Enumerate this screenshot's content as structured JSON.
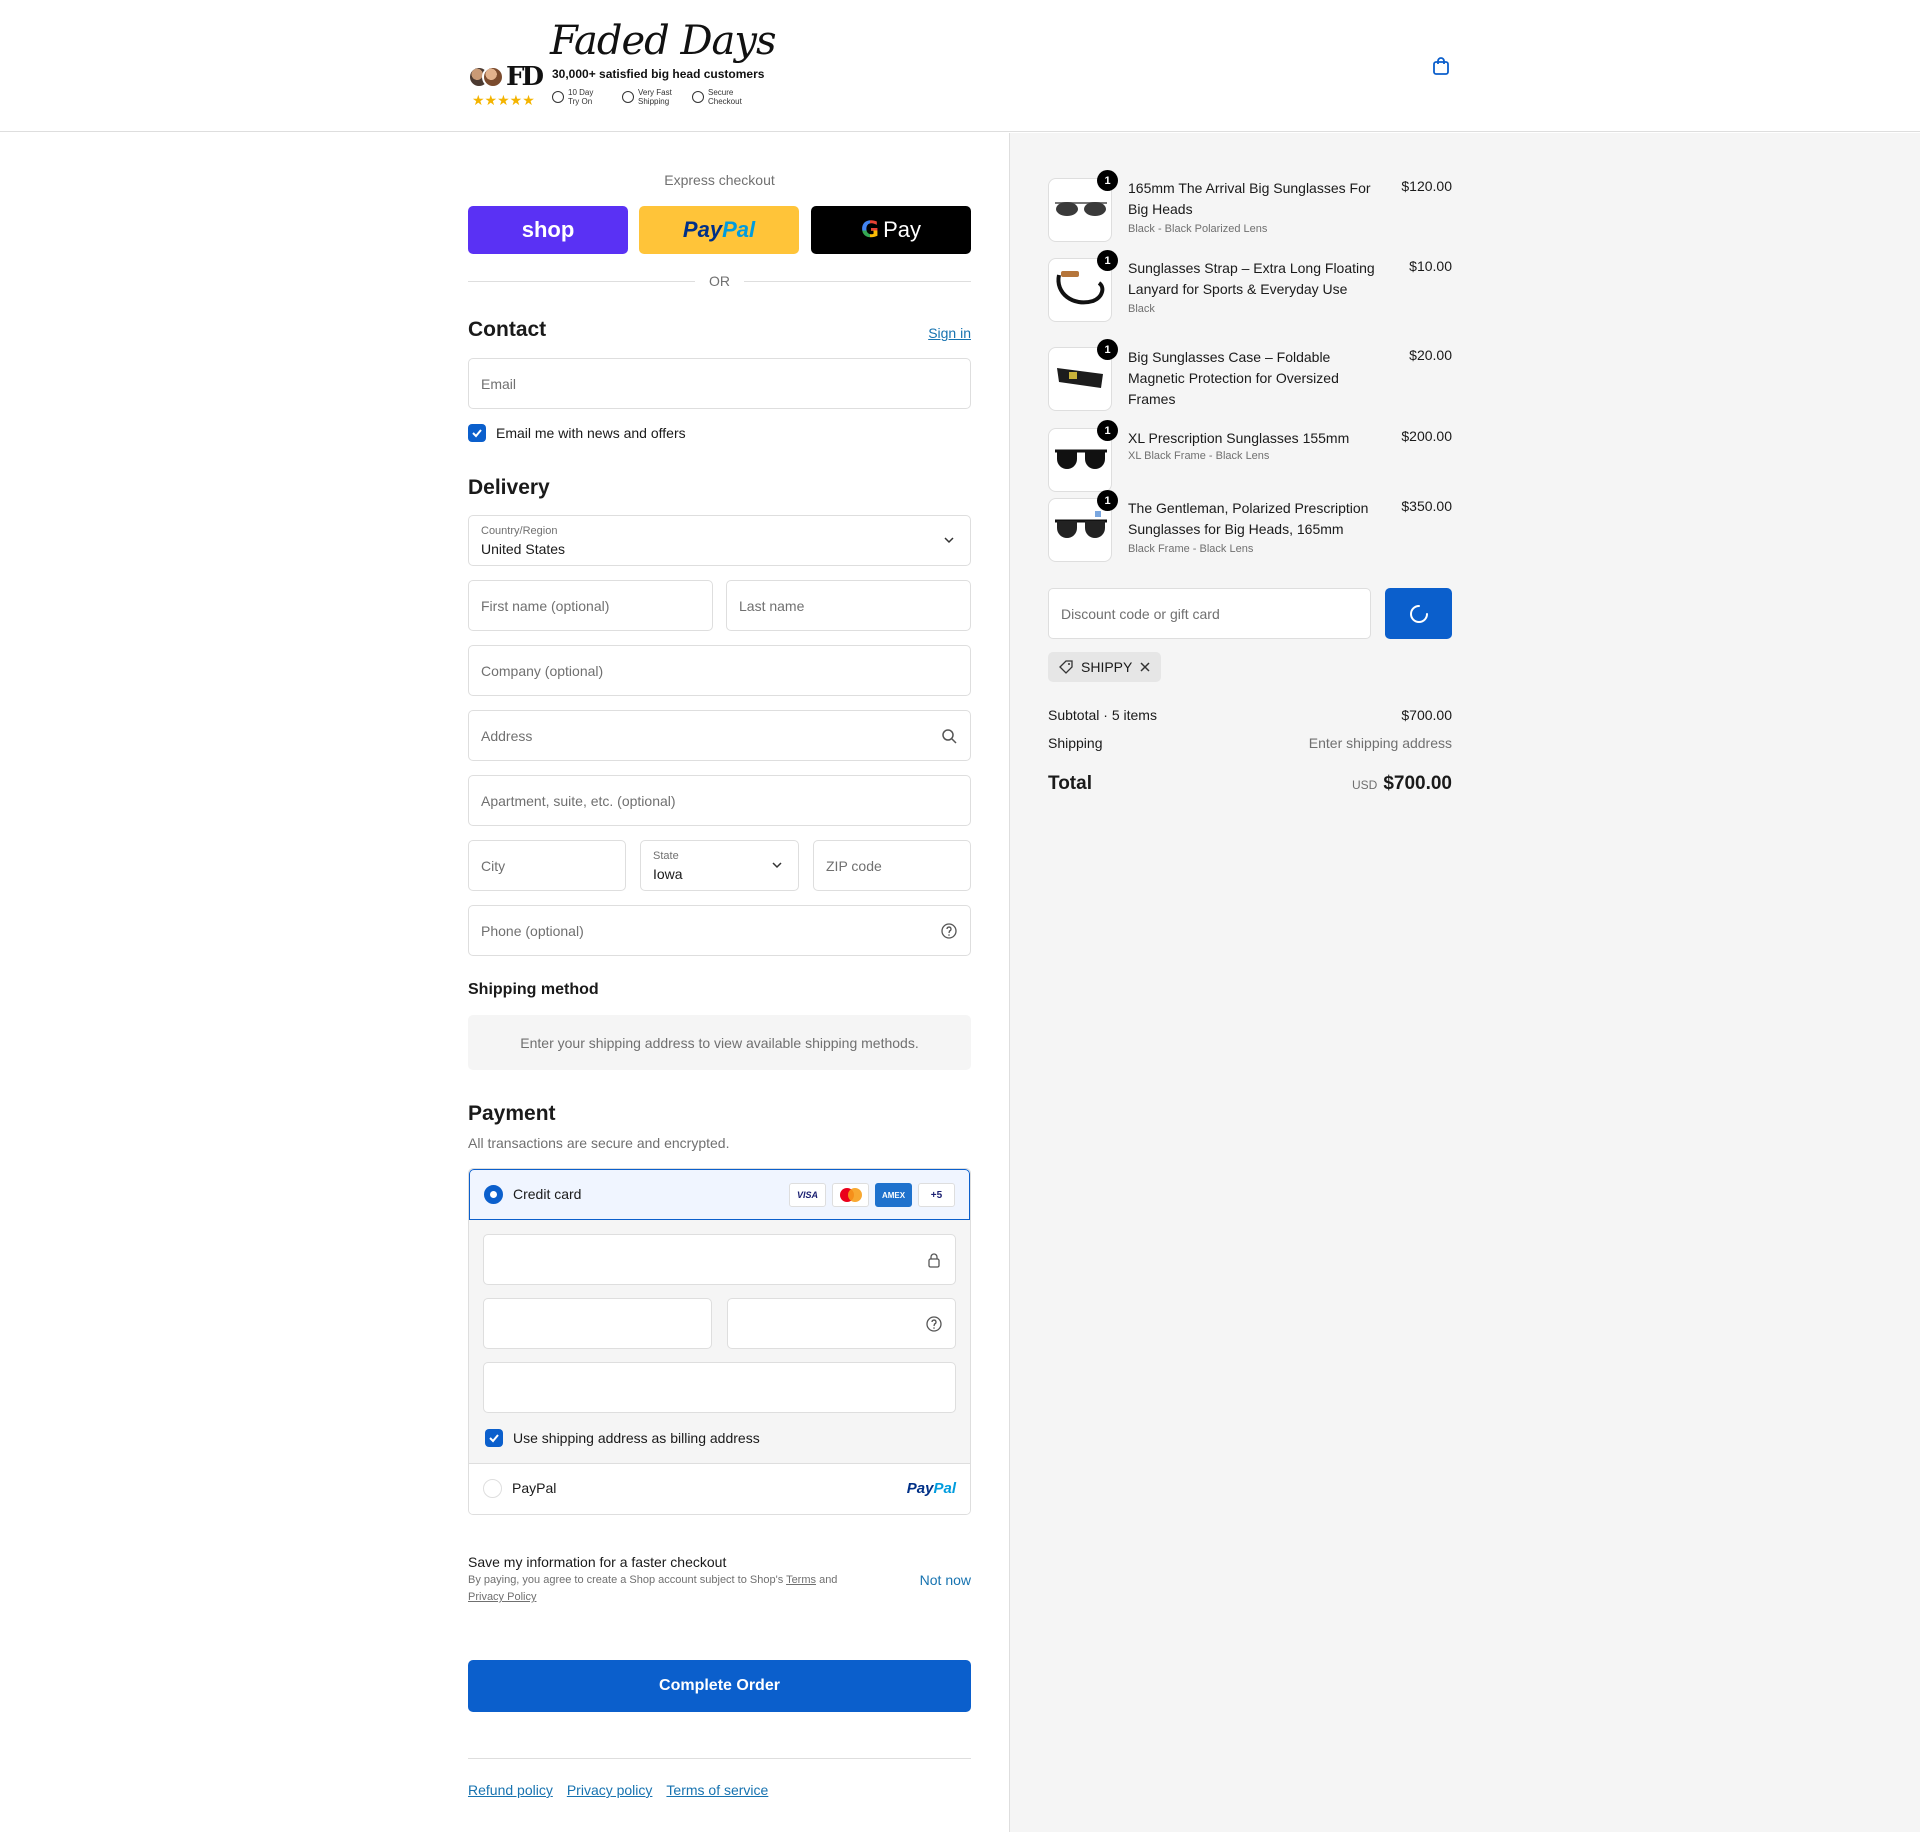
{
  "header": {
    "brand": "Faded Days",
    "monogram": "FD",
    "rating_stars": "★★★★★",
    "tagline": "30,000+ satisfied big head customers",
    "badges": [
      {
        "line1": "10 Day",
        "line2": "Try On"
      },
      {
        "line1": "Very Fast",
        "line2": "Shipping"
      },
      {
        "line1": "Secure",
        "line2": "Checkout"
      }
    ]
  },
  "express": {
    "title": "Express checkout",
    "shop_label": "shop",
    "paypal_part1": "Pay",
    "paypal_part2": "Pal",
    "gpay_g": "G",
    "gpay_label": "Pay",
    "or_label": "OR"
  },
  "contact": {
    "title": "Contact",
    "signin": "Sign in",
    "email_placeholder": "Email",
    "newsletter_label": "Email me with news and offers"
  },
  "delivery": {
    "title": "Delivery",
    "country_label": "Country/Region",
    "country_value": "United States",
    "first_name_ph": "First name (optional)",
    "last_name_ph": "Last name",
    "company_ph": "Company (optional)",
    "address_ph": "Address",
    "apartment_ph": "Apartment, suite, etc. (optional)",
    "city_ph": "City",
    "state_label": "State",
    "state_value": "Iowa",
    "zip_ph": "ZIP code",
    "phone_ph": "Phone (optional)"
  },
  "shipping_method": {
    "title": "Shipping method",
    "message": "Enter your shipping address to view available shipping methods."
  },
  "payment": {
    "title": "Payment",
    "subtitle": "All transactions are secure and encrypted.",
    "credit_card_label": "Credit card",
    "card_brands": {
      "visa": "VISA",
      "amex": "AMEX",
      "more": "+5"
    },
    "billing_same_label": "Use shipping address as billing address",
    "paypal_label": "PayPal",
    "paypal_logo_part1": "Pay",
    "paypal_logo_part2": "Pal"
  },
  "save_info": {
    "title": "Save my information for a faster checkout",
    "terms_prefix": "By paying, you agree to create a Shop account subject to Shop's ",
    "terms_link": "Terms",
    "terms_and": " and ",
    "privacy_link": "Privacy Policy",
    "not_now": "Not now"
  },
  "complete_button": "Complete Order",
  "footer_links": [
    "Refund policy",
    "Privacy policy",
    "Terms of service"
  ],
  "cart": {
    "items": [
      {
        "qty": "1",
        "name": "165mm The Arrival Big Sunglasses For Big Heads",
        "variant": "Black - Black Polarized Lens",
        "price": "$120.00",
        "icon": "sunglasses-icon"
      },
      {
        "qty": "1",
        "name": "Sunglasses Strap – Extra Long Floating Lanyard for Sports & Everyday Use",
        "variant": "Black",
        "price": "$10.00",
        "icon": "strap-icon"
      },
      {
        "qty": "1",
        "name": "Big Sunglasses Case – Foldable Magnetic Protection for Oversized Frames",
        "variant": "",
        "price": "$20.00",
        "icon": "case-icon"
      },
      {
        "qty": "1",
        "name": "XL Prescription Sunglasses 155mm",
        "variant": "XL Black Frame - Black Lens",
        "price": "$200.00",
        "icon": "sunglasses-icon"
      },
      {
        "qty": "1",
        "name": "The Gentleman, Polarized Prescription Sunglasses for Big Heads, 165mm",
        "variant": "Black Frame - Black Lens",
        "price": "$350.00",
        "icon": "sunglasses-icon"
      }
    ],
    "discount_placeholder": "Discount code or gift card",
    "applied_code": "SHIPPY",
    "subtotal_label": "Subtotal · 5 items",
    "subtotal_value": "$700.00",
    "shipping_label": "Shipping",
    "shipping_value": "Enter shipping address",
    "total_label": "Total",
    "total_currency": "USD",
    "total_value": "$700.00"
  },
  "colors": {
    "accent": "#0b5fcc",
    "shop_purple": "#5a31f4",
    "paypal_yellow": "#ffc439",
    "link": "#1773b0",
    "summary_bg": "#f5f5f5"
  }
}
